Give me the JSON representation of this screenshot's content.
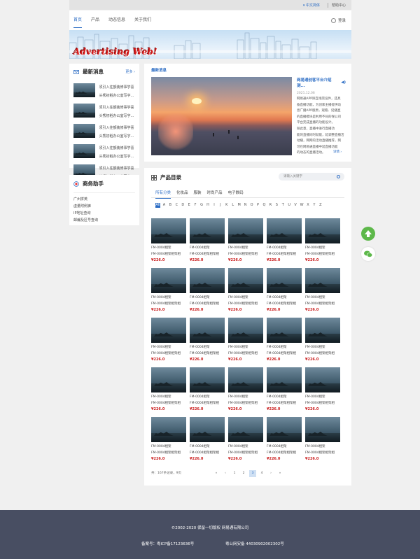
{
  "topbar": {
    "language": "中文简体",
    "help": "帮助中心"
  },
  "nav": {
    "items": [
      "首页",
      "产品",
      "动态信息",
      "关于我们"
    ],
    "active": "首页",
    "login": "登录"
  },
  "banner": {
    "logo_text": "Advertising Web!"
  },
  "news": {
    "title": "最新消息",
    "more": "更多",
    "items": [
      {
        "line1": "须引入往额装修事学喜",
        "line2": "头秀初稻办公室写字..."
      },
      {
        "line1": "须引入往额装修事学喜",
        "line2": "头秀初稻办公室写字..."
      },
      {
        "line1": "须引入往额装修事学喜",
        "line2": "头秀初稻办公室写字..."
      },
      {
        "line1": "须引入往额装修事学喜",
        "line2": "头秀初稻办公室写字..."
      },
      {
        "line1": "须引入往额装修事学喜",
        "line2": "头秀初稻办公室写字..."
      }
    ]
  },
  "assistant": {
    "title": "商务助手",
    "links": [
      "广州拼英",
      "虚量附例裤",
      "IP地址查询",
      "邮编及区号查询"
    ]
  },
  "latest": {
    "label": "最新消息",
    "article_title": "网易通创客平台介绍测...",
    "date": "2021.12.06",
    "body_lines": [
      "网易通APP除互线完设件，还具",
      "备直播功能，为创家主播提供动",
      "息广播APP版原，观看、延播直",
      "的直播模块是利用不同的保公司",
      "平台完成直播的功能设计。",
      "除此意，直播中进行直播功",
      "能的直播同时就能，延调整直播活",
      "动播，网网的活动直播推荐，网",
      "可在网易通直播中延直播功能",
      "的动态的直播活动。"
    ],
    "detail": "详情"
  },
  "products": {
    "title": "产品目录",
    "search_placeholder": "请输入关键字",
    "categories": [
      "所有分类",
      "化妆品",
      "服装",
      "时尚产品",
      "电子数码"
    ],
    "active_category": "所有分类",
    "letters": [
      "All",
      "A",
      "B",
      "C",
      "D",
      "E",
      "F",
      "G",
      "H",
      "I",
      "J",
      "K",
      "L",
      "M",
      "N",
      "O",
      "P",
      "Q",
      "R",
      "S",
      "T",
      "U",
      "V",
      "W",
      "X",
      "Y",
      "Z"
    ],
    "active_letter": "All",
    "item": {
      "name": "FM-0004相架",
      "desc": "FM-0004相架相架相",
      "price": "¥226.0"
    },
    "rows": 5,
    "cols": 5
  },
  "pager": {
    "info": "共：167条记录，9页",
    "first": "«",
    "prev": "‹",
    "pages": [
      "1",
      "2",
      "3",
      "4"
    ],
    "active_page": "3",
    "next": "›",
    "last": "»"
  },
  "side_buttons": {
    "top": "top-icon",
    "wechat": "wechat-icon"
  },
  "footer": {
    "copyright": "©2002-2020 保留一切版权 网易通有限公司",
    "icp": "备案号：粤ICP备17123636号",
    "police": "粤公网安备 44030902002302号"
  }
}
